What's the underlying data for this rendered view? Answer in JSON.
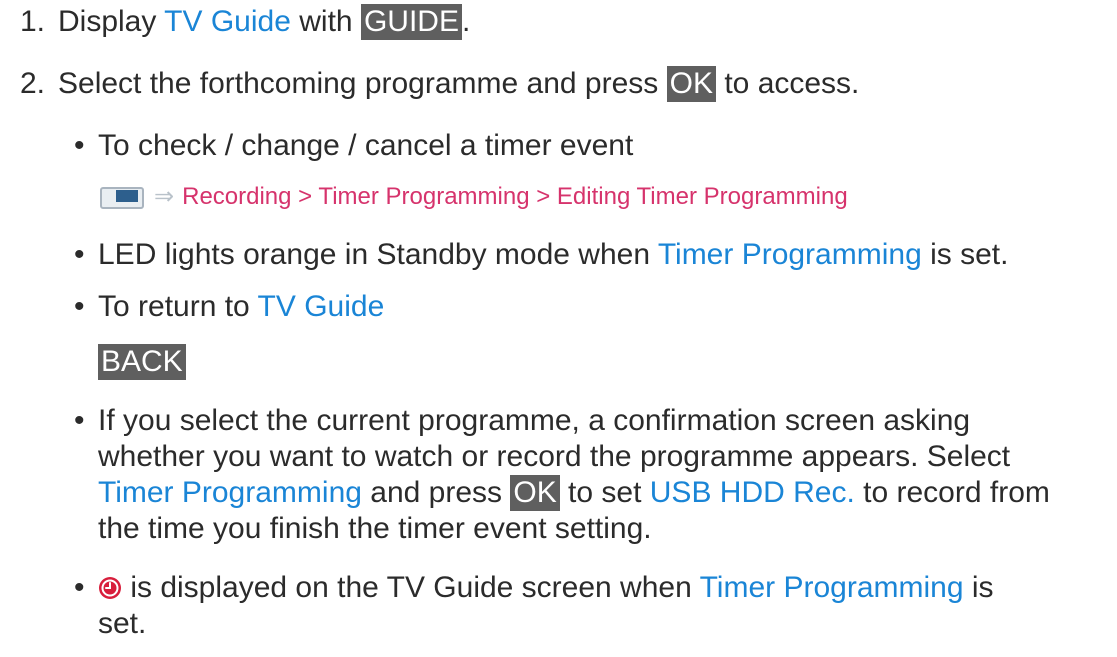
{
  "steps": [
    {
      "number": "1.",
      "t1": "Display ",
      "link1": "TV Guide",
      "t2": " with ",
      "key1": "GUIDE",
      "t3": "."
    },
    {
      "number": "2.",
      "t1": "Select the forthcoming programme and press ",
      "key1": "OK",
      "t2": " to access."
    }
  ],
  "bullets": {
    "check": {
      "symbol": "•",
      "text": "To check / change / cancel a timer event",
      "path": "Recording > Timer Programming > Editing Timer Programming",
      "path_arrow": "⇒",
      "icon": "menu-icon"
    },
    "led": {
      "symbol": "•",
      "t1": "LED lights orange in Standby mode when ",
      "link1": "Timer Programming",
      "t2": " is set."
    },
    "return": {
      "symbol": "•",
      "t1": "To return to ",
      "link1": "TV Guide",
      "key1": "BACK"
    },
    "current": {
      "symbol": "•",
      "line1": "If you select the current programme, a confirmation screen asking",
      "line2": "whether you want to watch or record the programme appears. Select",
      "l3_link1": "Timer Programming",
      "l3_t1": " and press ",
      "l3_key1": "OK",
      "l3_t2": " to set ",
      "l3_link2": "USB HDD Rec.",
      "l3_t3": " to record from",
      "line4": "the time you finish the timer event setting."
    },
    "clock": {
      "symbol": "•",
      "icon": "timer-clock-icon",
      "t1": " is displayed on the TV Guide screen when ",
      "link1": "Timer Programming",
      "t2": " is",
      "line2": "set."
    }
  },
  "colors": {
    "text": "#2b2b2b",
    "link": "#1a85d6",
    "breadcrumb": "#d6336c",
    "key_background": "#5f5f5f",
    "timer_icon": "#d81e3c"
  }
}
